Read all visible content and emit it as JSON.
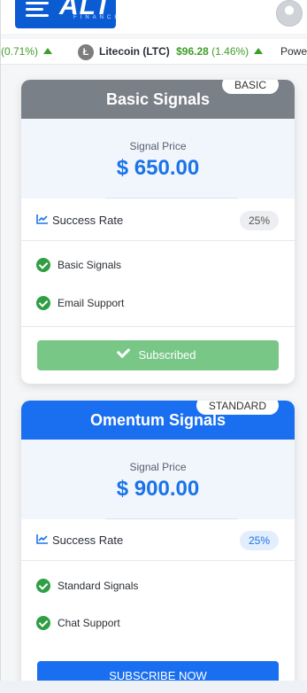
{
  "header": {
    "logo_text": "ALT",
    "logo_subtext": "FINANCE"
  },
  "ticker": {
    "items": [
      {
        "prefix": "",
        "name": "",
        "price": "",
        "change": "(0.71%)"
      },
      {
        "prefix": "Ł",
        "name": "Litecoin (LTC)",
        "price": "$96.28",
        "change": "(1.46%)"
      },
      {
        "prefix": "",
        "name": "Power",
        "price": "",
        "change": ""
      }
    ]
  },
  "cards": [
    {
      "title": "Basic Signals",
      "badge": "BASIC",
      "price_label": "Signal Price",
      "price": "$ 650.00",
      "success_label": "Success Rate",
      "success_rate": "25%",
      "features": [
        "Basic Signals",
        "Email Support"
      ],
      "button_label": "Subscribed",
      "head_color": "#7a8088",
      "button_color": "#79c787"
    },
    {
      "title": "Omentum Signals",
      "badge": "STANDARD",
      "price_label": "Signal Price",
      "price": "$ 900.00",
      "success_label": "Success Rate",
      "success_rate": "25%",
      "features": [
        "Standard Signals",
        "Chat Support"
      ],
      "button_label": "SUBSCRIBE NOW",
      "head_color": "#1a6ff0",
      "button_color": "#1a6ff0"
    }
  ]
}
